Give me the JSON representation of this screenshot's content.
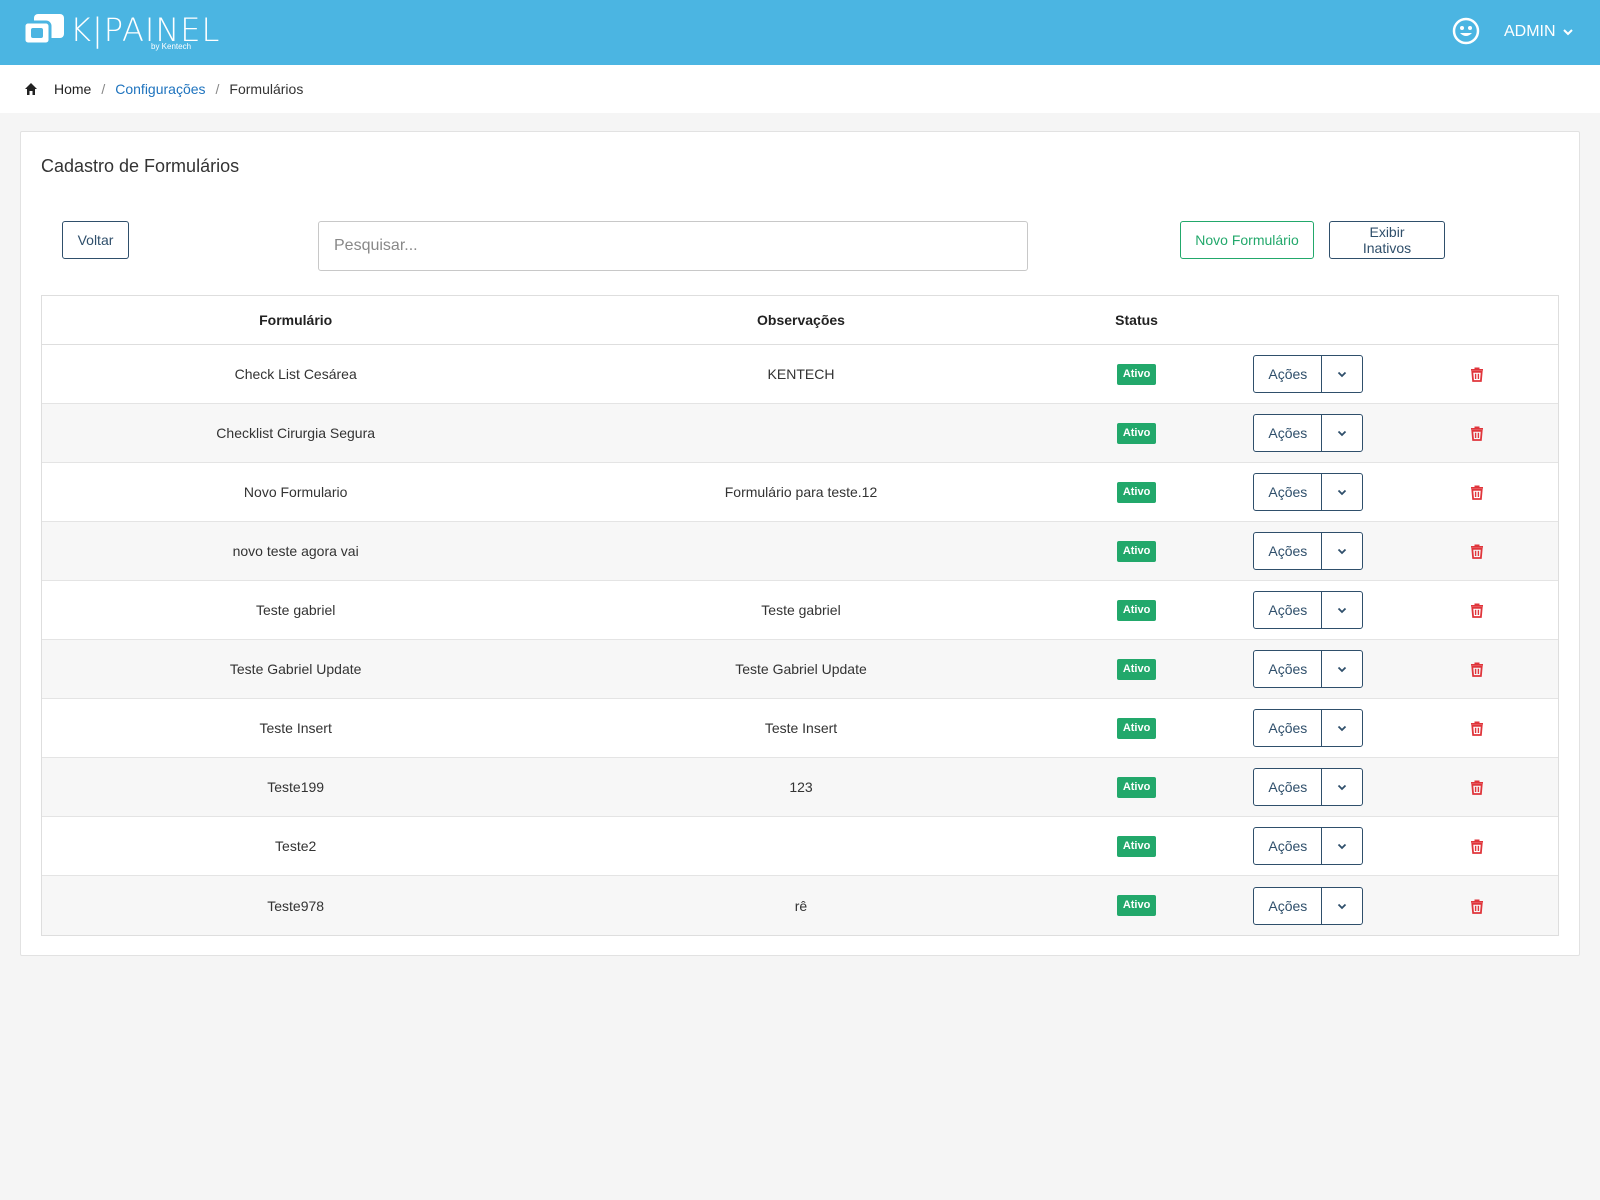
{
  "header": {
    "brand": "K|PAINEL",
    "by_text": "by Kentech",
    "user_label": "ADMIN",
    "icons": {
      "logo": "chat-bubble-logo-icon",
      "user": "smiley-icon",
      "dropdown": "chevron-down-icon"
    }
  },
  "breadcrumb": {
    "home": "Home",
    "config": "Configurações",
    "current": "Formulários",
    "separator": "/"
  },
  "card": {
    "title": "Cadastro de Formulários"
  },
  "toolbar": {
    "back_label": "Voltar",
    "search_placeholder": "Pesquisar...",
    "new_label": "Novo Formulário",
    "inactive_label": "Exibir Inativos"
  },
  "table": {
    "headers": {
      "form": "Formulário",
      "obs": "Observações",
      "status": "Status"
    },
    "actions_label": "Ações",
    "rows": [
      {
        "form": "Check List Cesárea",
        "obs": "KENTECH",
        "status": "Ativo"
      },
      {
        "form": "Checklist Cirurgia Segura",
        "obs": "",
        "status": "Ativo"
      },
      {
        "form": "Novo Formulario",
        "obs": "Formulário para teste.12",
        "status": "Ativo"
      },
      {
        "form": "novo teste agora vai",
        "obs": "",
        "status": "Ativo"
      },
      {
        "form": "Teste gabriel",
        "obs": "Teste gabriel",
        "status": "Ativo"
      },
      {
        "form": "Teste Gabriel Update",
        "obs": "Teste Gabriel Update",
        "status": "Ativo"
      },
      {
        "form": "Teste Insert",
        "obs": "Teste Insert",
        "status": "Ativo"
      },
      {
        "form": "Teste199",
        "obs": "123",
        "status": "Ativo"
      },
      {
        "form": "Teste2",
        "obs": "",
        "status": "Ativo"
      },
      {
        "form": "Teste978",
        "obs": "rê",
        "status": "Ativo"
      }
    ]
  },
  "colors": {
    "header_bg": "#4bb5e2",
    "accent_green": "#22a86b",
    "accent_navy": "#2f4f6b",
    "link_blue": "#1e73be",
    "danger_red": "#e0353b"
  }
}
